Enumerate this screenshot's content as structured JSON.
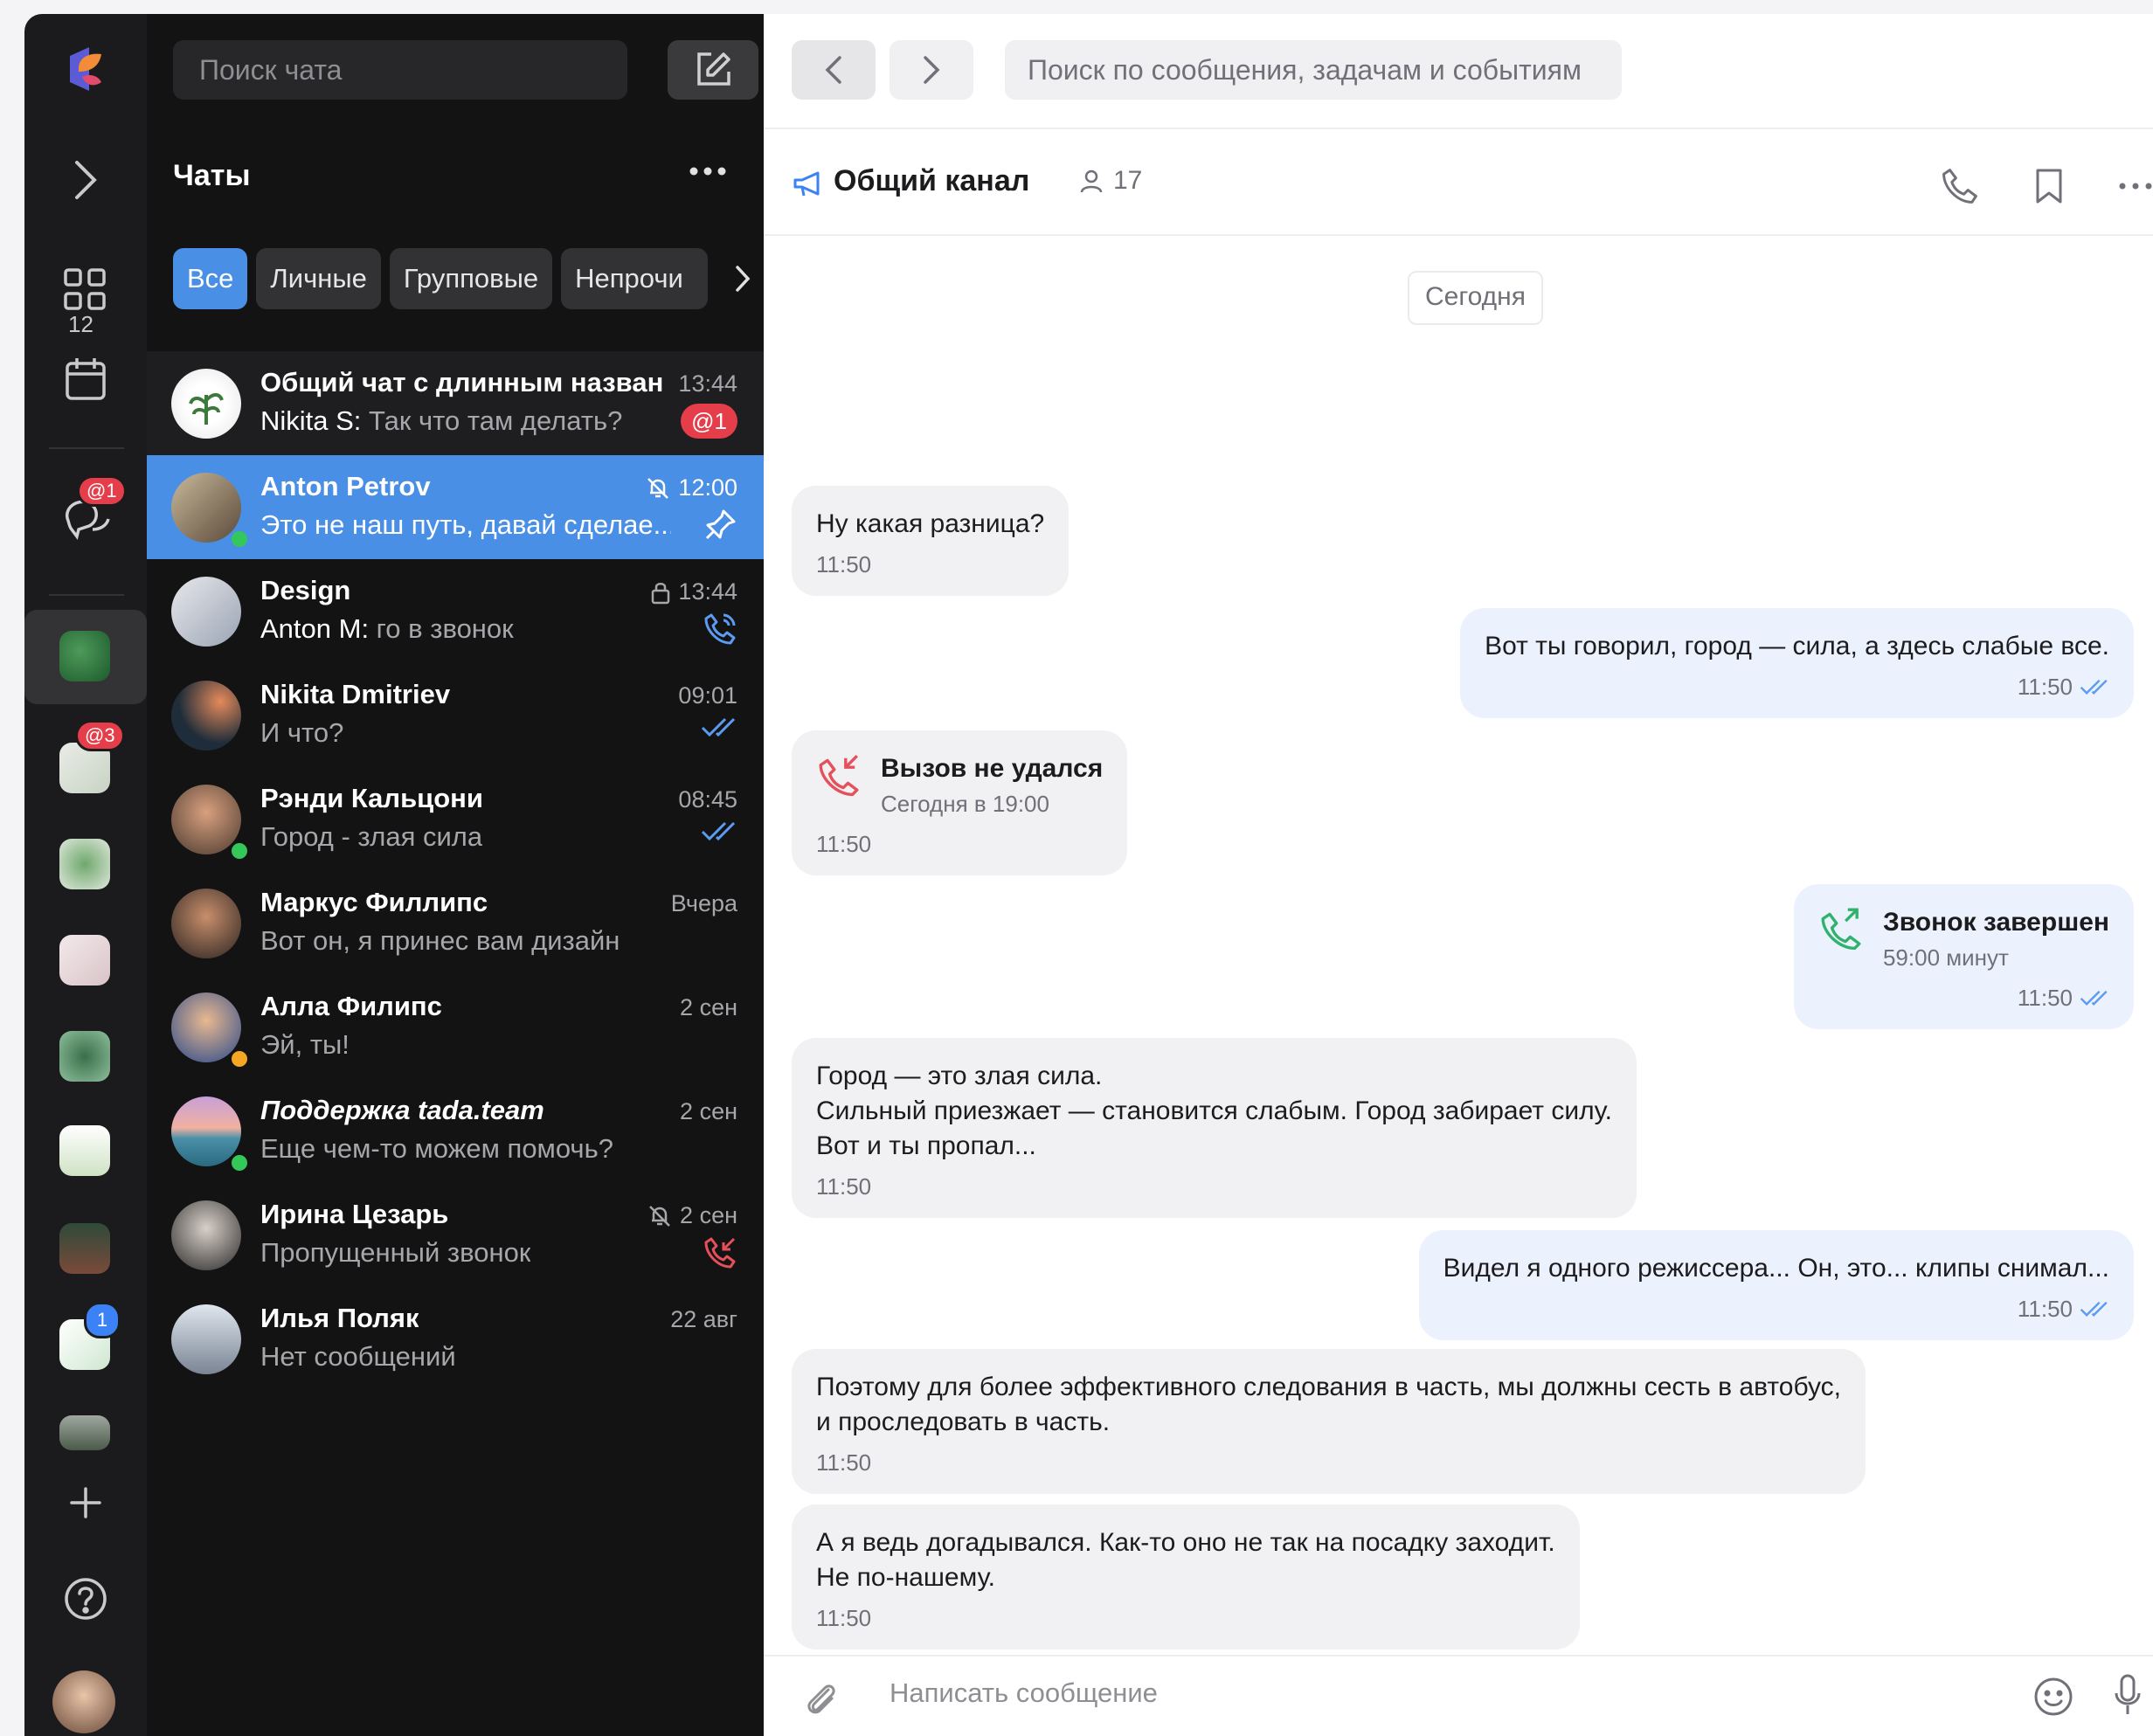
{
  "search_chat_placeholder": "Поиск чата",
  "list_title": "Чаты",
  "filters": [
    "Все",
    "Личные",
    "Групповые",
    "Непрочи"
  ],
  "rail": {
    "apps_count": "12",
    "chats_badge": "@1",
    "ws_badge_mention": "@3",
    "ws_badge_count": "1"
  },
  "chats": [
    {
      "name": "Общий чат с длинным назван...",
      "time": "13:44",
      "sender": "Nikita S:",
      "preview": " Так что там делать?",
      "mention": "@1"
    },
    {
      "name": "Anton Petrov",
      "time": "12:00",
      "sender": "",
      "preview": "Это не наш путь, давай сделае..."
    },
    {
      "name": "Design",
      "time": "13:44",
      "sender": "Anton M:",
      "preview": " го в звонок"
    },
    {
      "name": "Nikita Dmitriev",
      "time": "09:01",
      "sender": "",
      "preview": "И что?"
    },
    {
      "name": "Рэнди Кальцони",
      "time": "08:45",
      "sender": "",
      "preview": "Город - злая сила"
    },
    {
      "name": "Маркус Филлипс",
      "time": "Вчера",
      "sender": "",
      "preview": "Вот он, я принес вам дизайн"
    },
    {
      "name": "Алла Филипс",
      "time": "2 сен",
      "sender": "",
      "preview": "Эй, ты!"
    },
    {
      "name": "Поддержка tada.team",
      "time": "2 сен",
      "sender": "",
      "preview": "Еще чем-то можем помочь?"
    },
    {
      "name": "Ирина Цезарь",
      "time": "2 сен",
      "sender": "",
      "preview": "Пропущенный звонок"
    },
    {
      "name": "Илья Поляк",
      "time": "22 авг",
      "sender": "",
      "preview": "Нет сообщений"
    }
  ],
  "message_search_placeholder": "Поиск по сообщения, задачам и событиям",
  "channel": {
    "title": "Общий канал",
    "members": "17"
  },
  "date_divider": "Сегодня",
  "messages": [
    {
      "text": "Ну какая разница?",
      "time": "11:50"
    },
    {
      "text": "Вот ты говорил, город — сила, а здесь слабые все.",
      "time": "11:50"
    },
    {
      "call_title": "Вызов не удался",
      "call_sub": "Сегодня в 19:00",
      "time": "11:50"
    },
    {
      "call_title": "Звонок завершен",
      "call_sub": "59:00 минут",
      "time": "11:50"
    },
    {
      "text": "Город — это злая сила.\nСильный приезжает — становится слабым. Город забирает силу.\nВот и ты пропал...",
      "time": "11:50"
    },
    {
      "text": "Видел я одного режиссера... Он, это... клипы снимал...",
      "time": "11:50"
    },
    {
      "text": "Поэтому для более эффективного следования в часть, мы должны сесть в автобус,\nи проследовать в часть.",
      "time": "11:50"
    },
    {
      "text": "А я ведь догадывался. Как-то оно не так на посадку заходит.\nНе по-нашему.",
      "time": "11:50"
    }
  ],
  "composer_placeholder": "Написать сообщение",
  "colors": {
    "accent": "#4a8fe6",
    "danger": "#e53e4a",
    "online": "#34c759",
    "away": "#f5a623",
    "call_ok": "#2fb36b"
  }
}
